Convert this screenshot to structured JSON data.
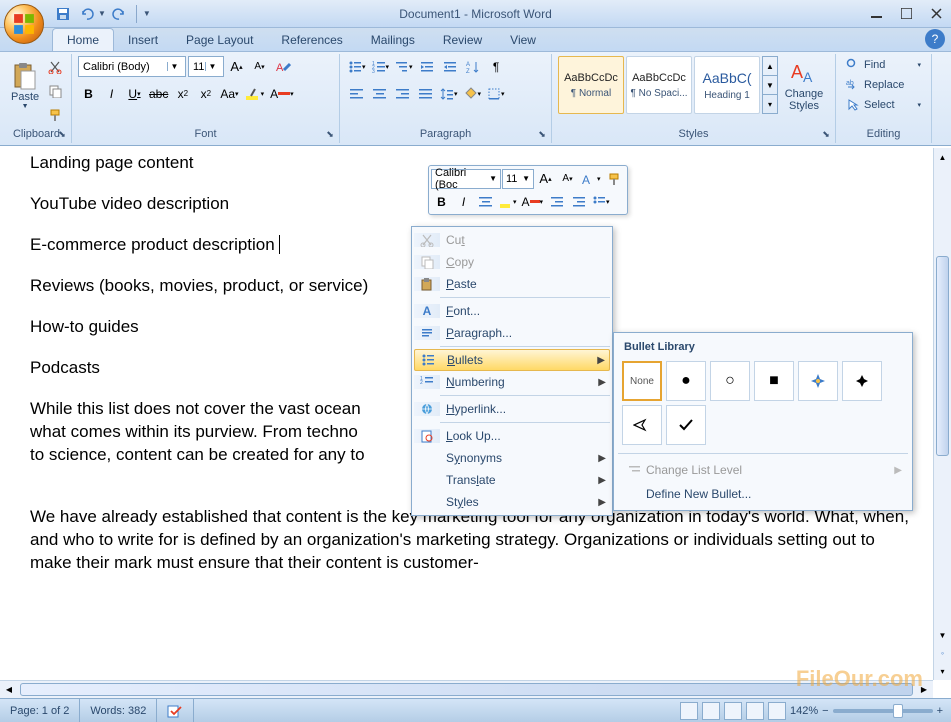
{
  "titlebar": {
    "title": "Document1 - Microsoft Word"
  },
  "qat": {
    "save": "save-icon",
    "undo": "undo-icon",
    "redo": "redo-icon"
  },
  "tabs": [
    "Home",
    "Insert",
    "Page Layout",
    "References",
    "Mailings",
    "Review",
    "View"
  ],
  "ribbon": {
    "clipboard": {
      "label": "Clipboard",
      "paste": "Paste"
    },
    "font": {
      "label": "Font",
      "name": "Calibri (Body)",
      "size": "11"
    },
    "paragraph": {
      "label": "Paragraph"
    },
    "styles": {
      "label": "Styles",
      "items": [
        {
          "sample": "AaBbCcDc",
          "name": "¶ Normal"
        },
        {
          "sample": "AaBbCcDc",
          "name": "¶ No Spaci..."
        },
        {
          "sample": "AaBbC(",
          "name": "Heading 1"
        }
      ],
      "change": "Change Styles"
    },
    "editing": {
      "label": "Editing",
      "find": "Find",
      "replace": "Replace",
      "select": "Select"
    }
  },
  "document": {
    "lines": [
      "Landing page content",
      "YouTube video description",
      "E-commerce product description",
      "Reviews (books, movies, product, or service)",
      "How-to guides",
      "Podcasts",
      "While this list does not cover the vast ocean",
      "what comes within its purview. From techno",
      "to science, content can be created for any to",
      "We have already established that content is the key marketing tool for any organization in today's world. What, when, and who to write for is defined by an organization's marketing strategy. Organizations or individuals setting out to make their mark must ensure that their content is customer-"
    ]
  },
  "mini_toolbar": {
    "font": "Calibri (Boc",
    "size": "11"
  },
  "context_menu": {
    "items": [
      {
        "icon": "cut",
        "label": "Cut",
        "key": "t",
        "disabled": true
      },
      {
        "icon": "copy",
        "label": "Copy",
        "key": "C",
        "disabled": true
      },
      {
        "icon": "paste",
        "label": "Paste",
        "key": "P"
      },
      {
        "icon": "font",
        "label": "Font...",
        "key": "F"
      },
      {
        "icon": "paragraph",
        "label": "Paragraph...",
        "key": "P"
      },
      {
        "icon": "bullets",
        "label": "Bullets",
        "key": "B",
        "submenu": true,
        "hover": true
      },
      {
        "icon": "numbering",
        "label": "Numbering",
        "key": "N",
        "submenu": true
      },
      {
        "icon": "hyperlink",
        "label": "Hyperlink...",
        "key": "H"
      },
      {
        "icon": "lookup",
        "label": "Look Up...",
        "key": "L"
      },
      {
        "icon": "synonyms",
        "label": "Synonyms",
        "key": "S",
        "submenu": true
      },
      {
        "icon": "translate",
        "label": "Translate",
        "key": "T",
        "submenu": true
      },
      {
        "icon": "styles",
        "label": "Styles",
        "key": "S",
        "submenu": true
      }
    ]
  },
  "bullet_panel": {
    "header": "Bullet Library",
    "none": "None",
    "change_level": "Change List Level",
    "define": "Define New Bullet..."
  },
  "statusbar": {
    "page": "Page: 1 of 2",
    "words": "Words: 382",
    "zoom": "142%"
  },
  "watermark": "FileOur.com"
}
